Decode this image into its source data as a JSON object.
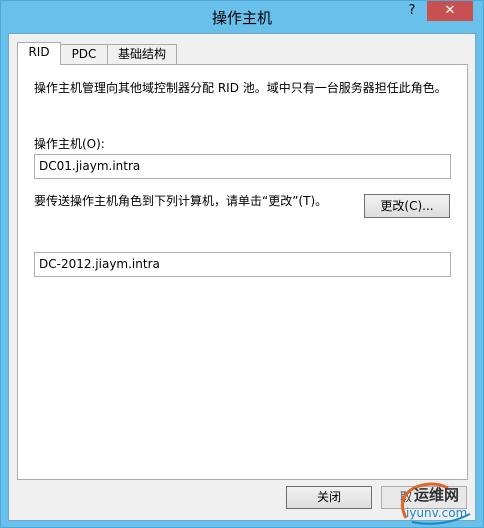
{
  "window": {
    "title": "操作主机",
    "help_button": "?",
    "close_button": "✕"
  },
  "tabs": [
    {
      "label": "RID",
      "active": true
    },
    {
      "label": "PDC",
      "active": false
    },
    {
      "label": "基础结构",
      "active": false
    }
  ],
  "rid_panel": {
    "description": "操作主机管理向其他域控制器分配 RID 池。域中只有一台服务器担任此角色。",
    "owner_label": "操作主机(O):",
    "owner_value": "DC01.jiaym.intra",
    "transfer_instruction": "要传送操作主机角色到下列计算机，请单击“更改”(T)。",
    "change_button": "更改(C)...",
    "target_value": "DC-2012.jiaym.intra"
  },
  "footer": {
    "close_button": "关闭",
    "cancel_button": "取"
  },
  "watermark": {
    "line1": "运维网",
    "line2": "iyunv.com"
  }
}
